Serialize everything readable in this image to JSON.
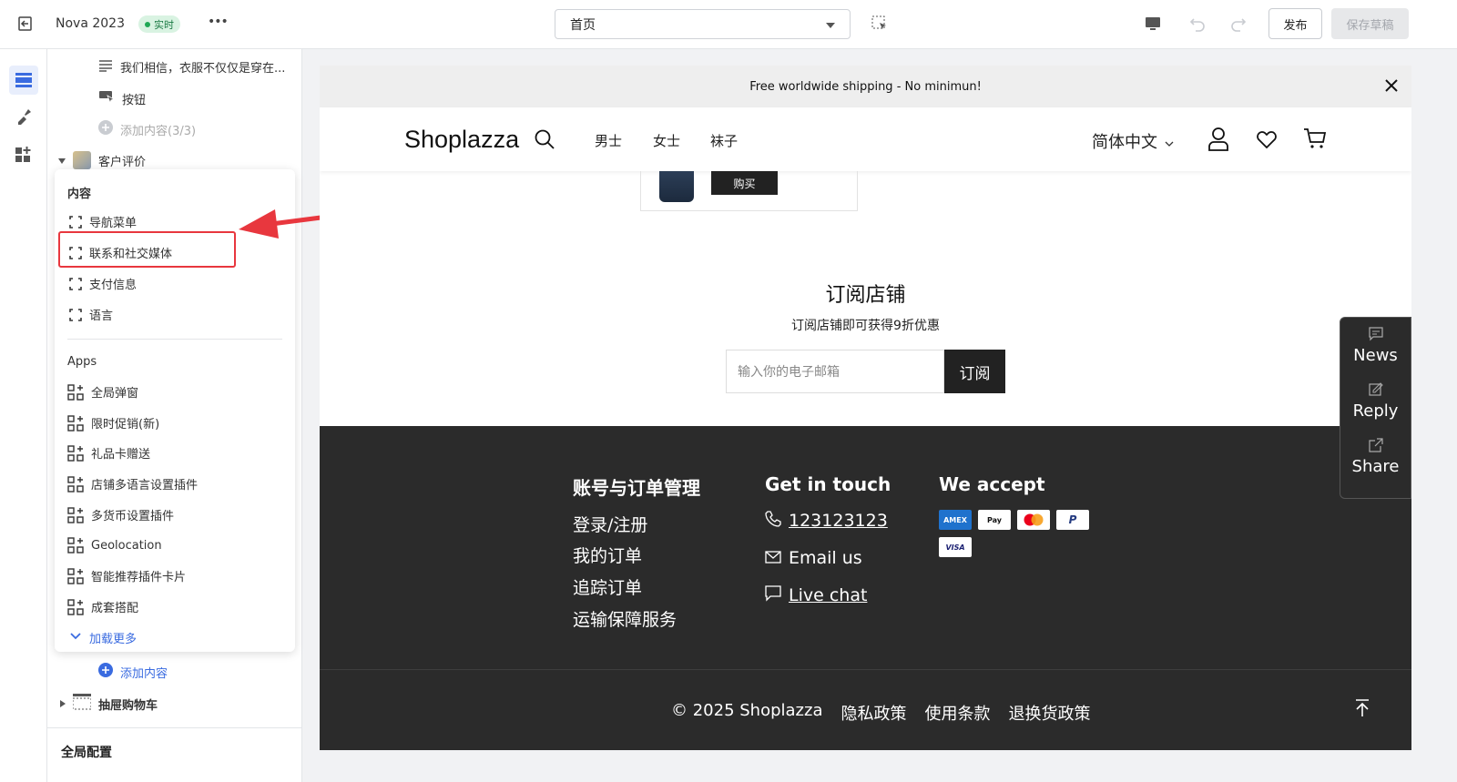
{
  "topbar": {
    "theme_name": "Nova 2023",
    "live_badge": "实时",
    "more": "•••",
    "page_select": "首页",
    "publish": "发布",
    "save_draft": "保存草稿"
  },
  "panel": {
    "item_text": "我们相信，衣服不仅仅是穿在...",
    "item_button": "按钮",
    "add_content_limited": "添加内容(3/3)",
    "section_reviews": "客户评价",
    "add_content": "添加内容",
    "section_drawer_cart": "抽屉购物车",
    "global_config": "全局配置"
  },
  "popup": {
    "content_heading": "内容",
    "content_items": [
      "导航菜单",
      "联系和社交媒体",
      "支付信息",
      "语言"
    ],
    "apps_heading": "Apps",
    "app_items": [
      "全局弹窗",
      "限时促销(新)",
      "礼品卡赠送",
      "店铺多语言设置插件",
      "多货币设置插件",
      "Geolocation",
      "智能推荐插件卡片",
      "成套搭配"
    ],
    "load_more": "加载更多"
  },
  "store": {
    "announcement": "Free worldwide shipping - No minimun!",
    "logo": "Shoplazza",
    "nav": [
      "男士",
      "女士",
      "袜子"
    ],
    "language": "简体中文",
    "buy_button": "购买",
    "subscribe_title": "订阅店铺",
    "subscribe_desc": "订阅店铺即可获得9折优惠",
    "email_placeholder": "输入你的电子邮箱",
    "subscribe_button": "订阅"
  },
  "footer": {
    "col1_title": "账号与订单管理",
    "col1_links": [
      "登录/注册",
      "我的订单",
      "追踪订单",
      "运输保障服务"
    ],
    "col2_title": "Get in touch",
    "phone": "123123123",
    "email": "Email us",
    "chat": "Live chat",
    "col3_title": "We accept",
    "cards": [
      "AMEX",
      "Pay",
      "",
      "P",
      "VISA"
    ],
    "copyright": "© 2025 Shoplazza",
    "policies": [
      "隐私政策",
      "使用条款",
      "退换货政策"
    ]
  },
  "floating": [
    "News",
    "Reply",
    "Share"
  ],
  "colors": {
    "accent": "#3a6be0",
    "highlight": "#e8373e",
    "live": "#1fa855",
    "footer_bg": "#2b2b2b"
  }
}
